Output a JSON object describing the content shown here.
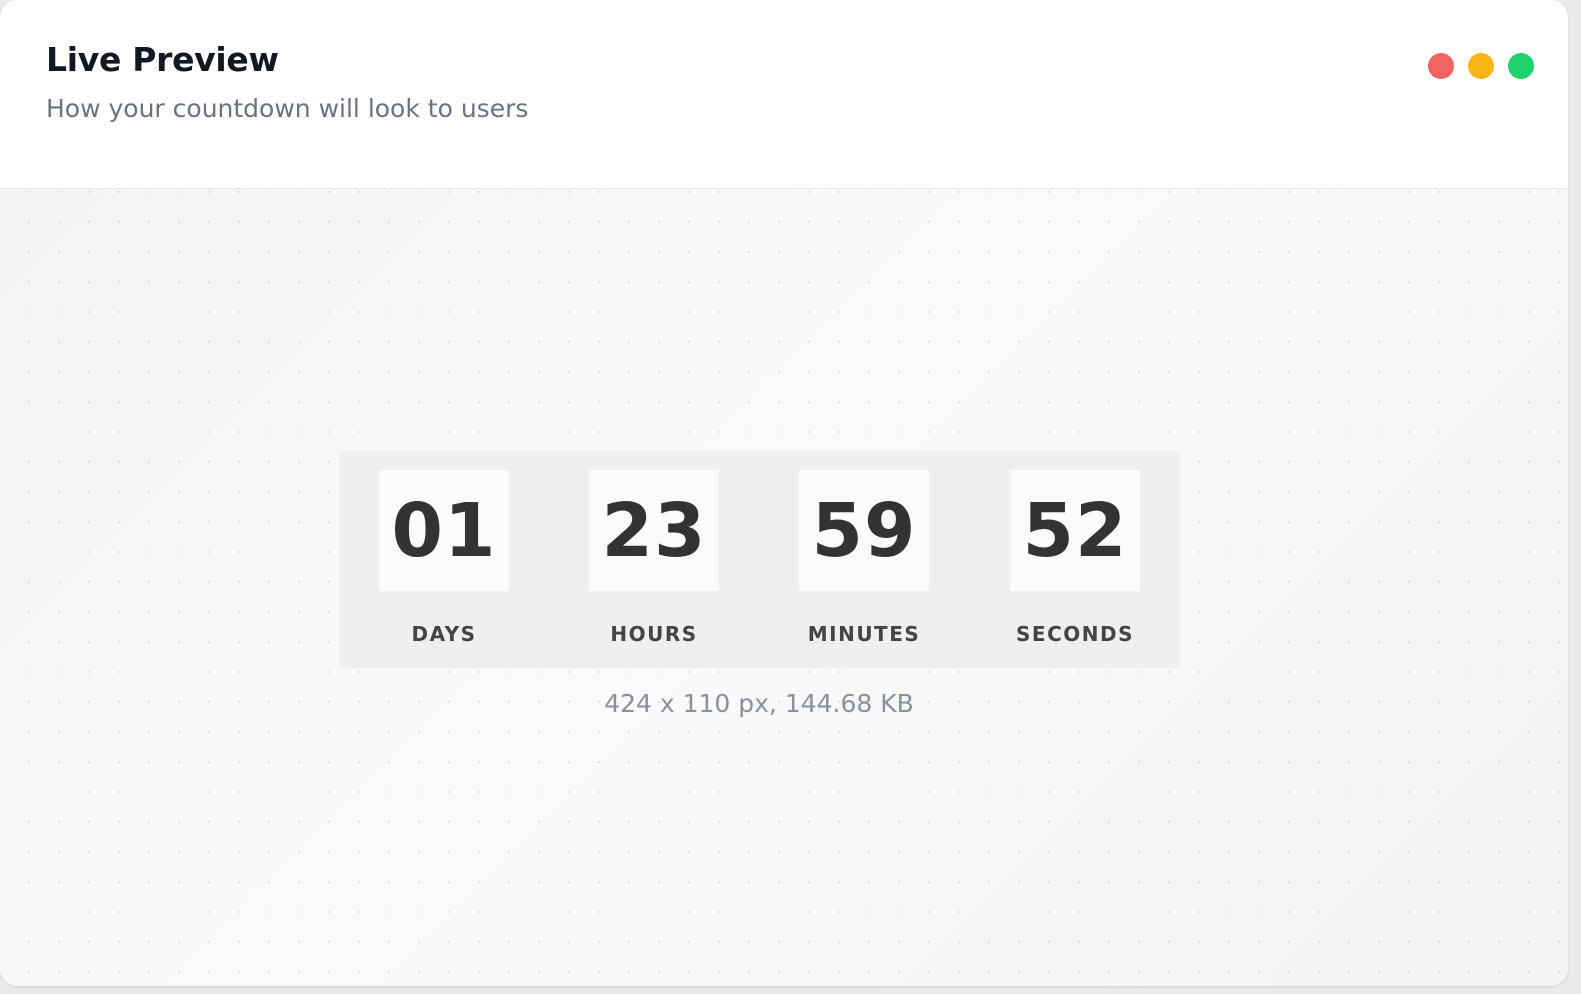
{
  "panel": {
    "title": "Live Preview",
    "subtitle": "How your countdown will look to users"
  },
  "window_controls": [
    {
      "name": "close",
      "color": "#f26464"
    },
    {
      "name": "minimize",
      "color": "#fbb416"
    },
    {
      "name": "maximize",
      "color": "#1fd36a"
    }
  ],
  "countdown": {
    "units": [
      {
        "value": "01",
        "label": "DAYS"
      },
      {
        "value": "23",
        "label": "HOURS"
      },
      {
        "value": "59",
        "label": "MINUTES"
      },
      {
        "value": "52",
        "label": "SECONDS"
      }
    ]
  },
  "image_info": "424 x 110 px, 144.68 KB"
}
